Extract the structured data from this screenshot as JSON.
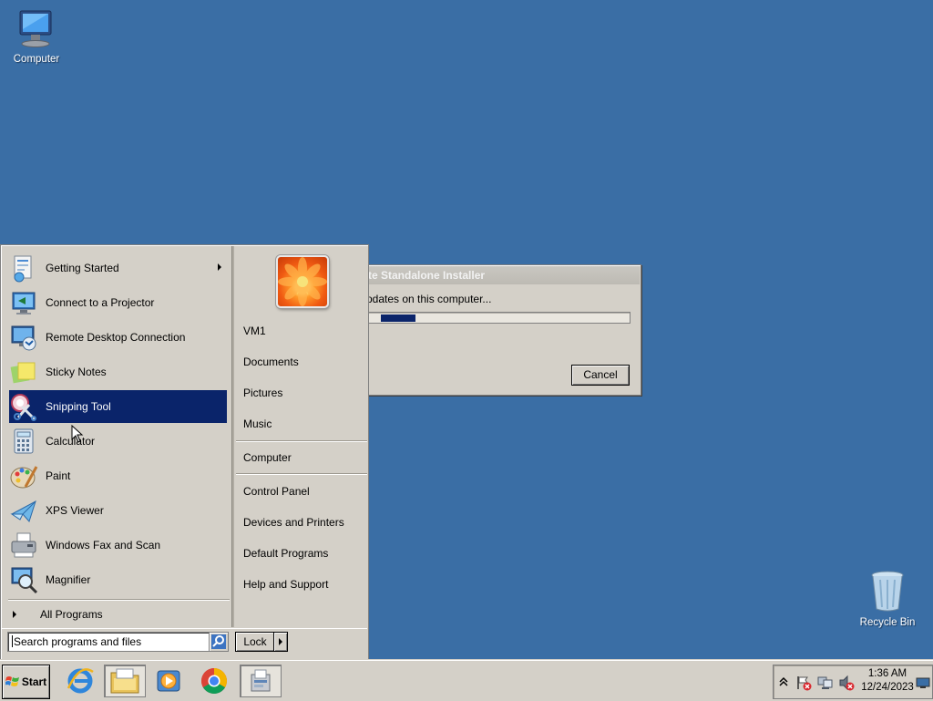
{
  "desktop": {
    "icons": [
      {
        "label": "Computer",
        "icon": "computer-icon"
      },
      {
        "label": "Recycle Bin",
        "icon": "recycle-bin-icon"
      }
    ],
    "background_color": "#3a6ea5"
  },
  "dialog": {
    "title": "te Standalone Installer",
    "message": "pdates on this computer...",
    "cancel_label": "Cancel",
    "progress_color": "#0a246a"
  },
  "start_menu": {
    "programs": [
      {
        "label": "Getting Started",
        "icon": "getting-started-icon",
        "has_submenu": true
      },
      {
        "label": "Connect to a Projector",
        "icon": "projector-icon"
      },
      {
        "label": "Remote Desktop Connection",
        "icon": "remote-desktop-icon"
      },
      {
        "label": "Sticky Notes",
        "icon": "sticky-notes-icon"
      },
      {
        "label": "Snipping Tool",
        "icon": "snipping-tool-icon",
        "selected": true
      },
      {
        "label": "Calculator",
        "icon": "calculator-icon"
      },
      {
        "label": "Paint",
        "icon": "paint-icon"
      },
      {
        "label": "XPS Viewer",
        "icon": "xps-viewer-icon"
      },
      {
        "label": "Windows Fax and Scan",
        "icon": "fax-scan-icon"
      },
      {
        "label": "Magnifier",
        "icon": "magnifier-icon"
      }
    ],
    "all_programs_label": "All Programs",
    "places": [
      {
        "label": "VM1"
      },
      {
        "label": "Documents"
      },
      {
        "label": "Pictures"
      },
      {
        "label": "Music"
      },
      {
        "label": "Computer"
      },
      {
        "label": "Control Panel"
      },
      {
        "label": "Devices and Printers"
      },
      {
        "label": "Default Programs"
      },
      {
        "label": "Help and Support"
      }
    ],
    "search_placeholder": "Search programs and files",
    "lock_label": "Lock",
    "selection_color": "#0a246a"
  },
  "taskbar": {
    "start_label": "Start",
    "pinned": [
      {
        "name": "internet-explorer-icon"
      },
      {
        "name": "windows-explorer-icon",
        "active": true
      },
      {
        "name": "media-player-icon"
      },
      {
        "name": "chrome-icon"
      },
      {
        "name": "installer-icon",
        "active": true
      }
    ],
    "clock_time": "1:36 AM",
    "clock_date": "12/24/2023"
  }
}
